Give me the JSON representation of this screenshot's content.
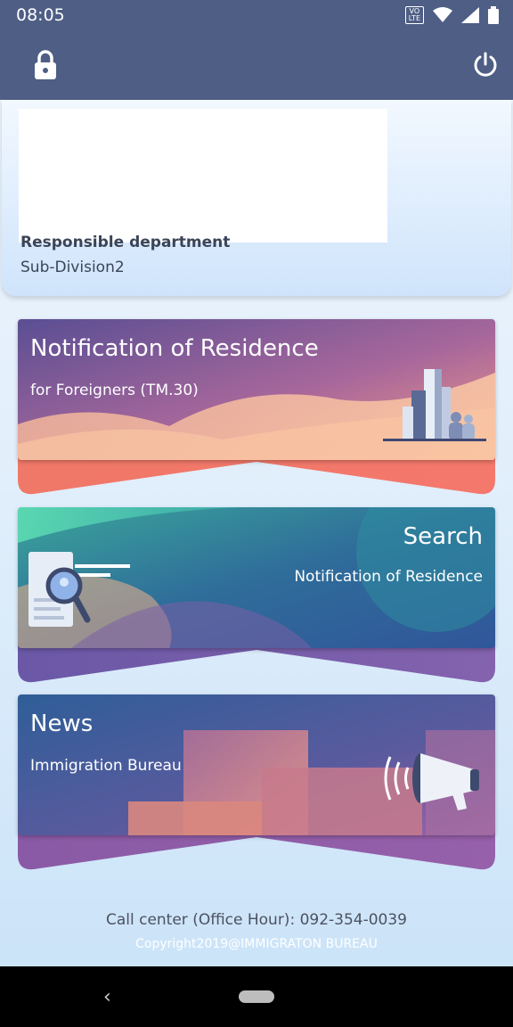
{
  "status_bar": {
    "time": "08:05",
    "volte_line1": "VO",
    "volte_line2": "LTE"
  },
  "app_bar": {
    "lock_icon": "lock-icon",
    "power_icon": "power-icon"
  },
  "profile": {
    "department_label": "Responsible department",
    "department_value": "Sub-Division2"
  },
  "cards": [
    {
      "title": "Notification of Residence",
      "subtitle": "for Foreigners (TM.30)"
    },
    {
      "title": "Search",
      "subtitle": "Notification of Residence"
    },
    {
      "title": "News",
      "subtitle": "Immigration Bureau"
    }
  ],
  "footer": {
    "call_center": "Call center (Office Hour): 092-354-0039",
    "copyright": "Copyright2019@IMMIGRATON BUREAU"
  },
  "colors": {
    "header": "#4e5e85",
    "card1_accent": "#f07a70",
    "card2_accent": "#3a4f9a",
    "card3_accent": "#8a5aa8"
  }
}
